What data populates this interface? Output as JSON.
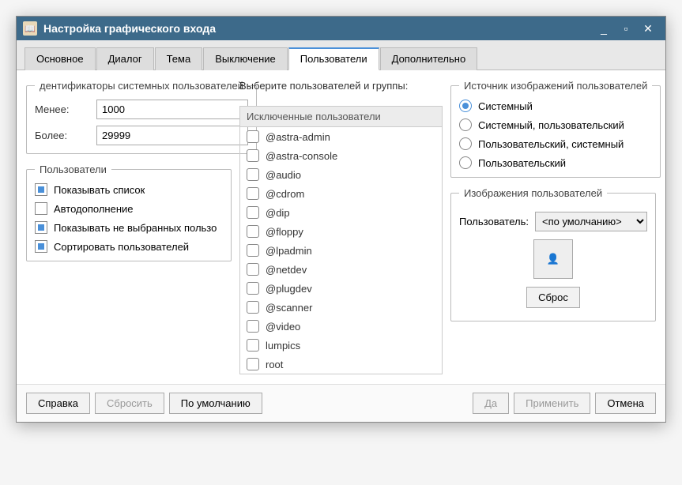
{
  "window": {
    "title": "Настройка графического входа"
  },
  "tabs": {
    "items": [
      {
        "label": "Основное"
      },
      {
        "label": "Диалог"
      },
      {
        "label": "Тема"
      },
      {
        "label": "Выключение"
      },
      {
        "label": "Пользователи"
      },
      {
        "label": "Дополнительно"
      }
    ],
    "active_index": 4
  },
  "ids_group": {
    "legend": "дентификаторы системных пользователей",
    "less_label": "Менее:",
    "less_value": "1000",
    "more_label": "Более:",
    "more_value": "29999"
  },
  "users_group": {
    "legend": "Пользователи",
    "items": [
      {
        "label": "Показывать список",
        "checked": true
      },
      {
        "label": "Автодополнение",
        "checked": false
      },
      {
        "label": "Показывать не выбранных пользо",
        "checked": true
      },
      {
        "label": "Сортировать пользователей",
        "checked": true
      }
    ]
  },
  "select_section": {
    "header": "Выберите пользователей и группы:",
    "list_header": "Исключенные пользователи",
    "items": [
      {
        "label": "@astra-admin"
      },
      {
        "label": "@astra-console"
      },
      {
        "label": "@audio"
      },
      {
        "label": "@cdrom"
      },
      {
        "label": "@dip"
      },
      {
        "label": "@floppy"
      },
      {
        "label": "@lpadmin"
      },
      {
        "label": "@netdev"
      },
      {
        "label": "@plugdev"
      },
      {
        "label": "@scanner"
      },
      {
        "label": "@video"
      },
      {
        "label": "lumpics"
      },
      {
        "label": "root"
      }
    ]
  },
  "source_group": {
    "legend": "Источник изображений пользователей",
    "items": [
      {
        "label": "Системный",
        "checked": true
      },
      {
        "label": "Системный, пользовательский",
        "checked": false
      },
      {
        "label": "Пользовательский, системный",
        "checked": false
      },
      {
        "label": "Пользовательский",
        "checked": false
      }
    ]
  },
  "images_group": {
    "legend": "Изображения пользователей",
    "user_label": "Пользователь:",
    "default_option": "<по умолчанию>",
    "reset_btn": "Сброс"
  },
  "footer": {
    "help": "Справка",
    "reset": "Сбросить",
    "defaults": "По умолчанию",
    "ok": "Да",
    "apply": "Применить",
    "cancel": "Отмена"
  }
}
